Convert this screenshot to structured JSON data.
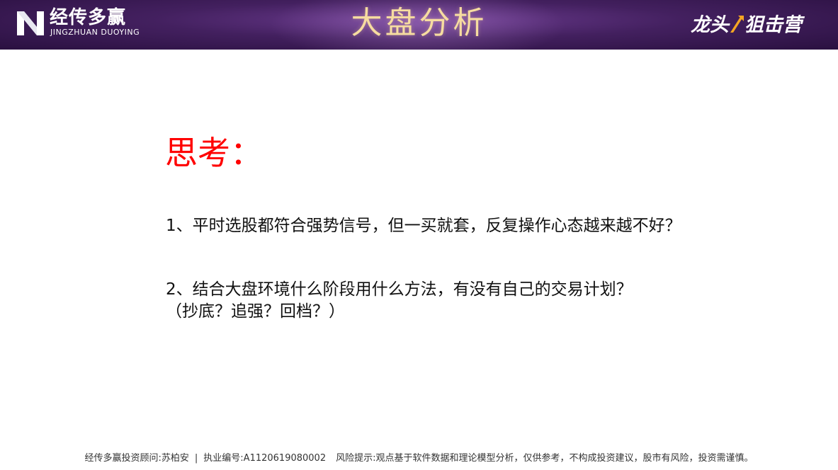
{
  "header": {
    "logo_cn": "经传多赢",
    "logo_en": "JINGZHUAN DUOYING",
    "title": "大盘分析",
    "badge_left": "龙头",
    "badge_right": "狙击营"
  },
  "content": {
    "heading": "思考：",
    "question_1": "1、平时选股都符合强势信号，但一买就套，反复操作心态越来越不好？",
    "question_2": "2、结合大盘环境什么阶段用什么方法，有没有自己的交易计划？",
    "question_2_sub": "（抄底？追强？回档？）"
  },
  "footer": {
    "advisor": "经传多赢投资顾问:苏柏安",
    "separator": "|",
    "license": "执业编号:A1120619080002",
    "risk": "风险提示:观点基于软件数据和理论模型分析，仅供参考，不构成投资建议，股市有风险，投资需谨慎。"
  },
  "colors": {
    "header_bg": "#43205f",
    "title_gold": "#f6dca0",
    "heading_red": "#ff0000",
    "badge_accent": "#f5a623"
  }
}
